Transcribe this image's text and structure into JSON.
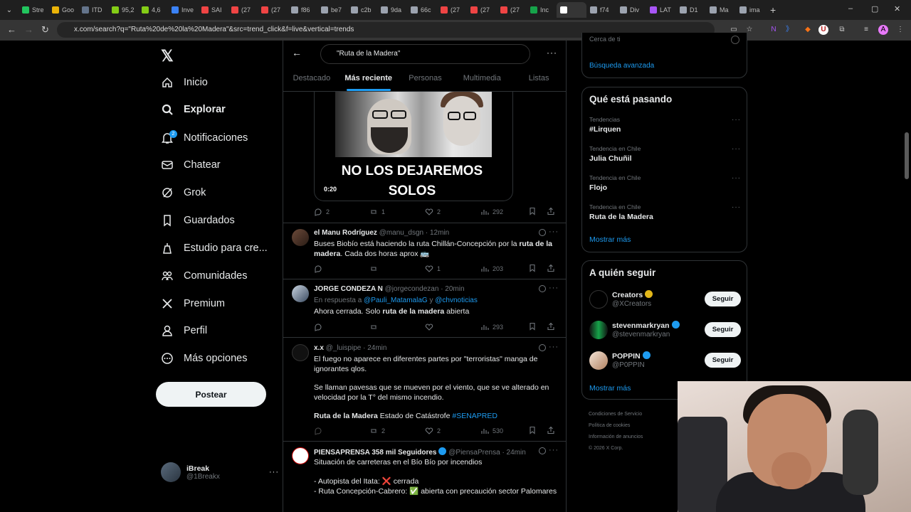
{
  "browser": {
    "tabs": [
      "Stre",
      "Goo",
      "ITD",
      "95,2",
      "4,6",
      "Inve",
      "SAI",
      "(27",
      "(27",
      "f86",
      "be7",
      "c2b",
      "9da",
      "66c",
      "(27",
      "(27",
      "(27",
      "Inc",
      "",
      "f74",
      "Div",
      "LAT",
      "D1",
      "Ma",
      "ima"
    ],
    "url": "x.com/search?q=\"Ruta%20de%20la%20Madera\"&src=trend_click&f=live&vertical=trends"
  },
  "nav": {
    "items": [
      {
        "label": "Inicio",
        "icon": "home-icon"
      },
      {
        "label": "Explorar",
        "icon": "search-icon"
      },
      {
        "label": "Notificaciones",
        "icon": "bell-icon",
        "badge": "2"
      },
      {
        "label": "Chatear",
        "icon": "mail-icon"
      },
      {
        "label": "Grok",
        "icon": "grok-icon"
      },
      {
        "label": "Guardados",
        "icon": "bookmark-icon"
      },
      {
        "label": "Estudio para cre...",
        "icon": "studio-icon"
      },
      {
        "label": "Comunidades",
        "icon": "communities-icon"
      },
      {
        "label": "Premium",
        "icon": "x-icon"
      },
      {
        "label": "Perfil",
        "icon": "person-icon"
      },
      {
        "label": "Más opciones",
        "icon": "more-circle-icon"
      }
    ],
    "post_label": "Postear",
    "profile": {
      "name": "iBreak",
      "handle": "@1Breakx"
    }
  },
  "search": {
    "query": "\"Ruta de la Madera\"",
    "tabs": [
      "Destacado",
      "Más reciente",
      "Personas",
      "Multimedia",
      "Listas"
    ],
    "active_tab": "Más reciente"
  },
  "media_post": {
    "caption_line1": "NO LOS DEJAREMOS",
    "caption_line2": "SOLOS",
    "duration": "0:20",
    "replies": "2",
    "reposts": "1",
    "likes": "2",
    "views": "292"
  },
  "tweets": [
    {
      "name": "el Manu Rodríguez",
      "handle": "@manu_dsgn",
      "time": "· 12min",
      "text_pre": "Buses Biobío está haciendo la ruta Chillán-Concepción por la ",
      "text_bold": "ruta de la madera",
      "text_post": ". Cada dos horas aprox 🚌",
      "replies": "",
      "reposts": "",
      "likes": "1",
      "views": "203"
    },
    {
      "name": "JORGE CONDEZA N",
      "handle": "@jorgecondezan",
      "time": "· 20min",
      "reply_prefix": "En respuesta a ",
      "reply_a": "@Pauli_MatamalaG",
      "reply_and": " y ",
      "reply_b": "@chvnoticias",
      "text_pre": "Ahora cerrada. Solo ",
      "text_bold": "ruta de la madera",
      "text_post": " abierta",
      "replies": "",
      "reposts": "",
      "likes": "",
      "views": "293"
    },
    {
      "name": "x.x",
      "handle": "@_luispipe",
      "time": "· 24min",
      "line1": "El fuego no aparece en diferentes partes por \"terroristas\" manga de ignorantes qlos.",
      "line2": "Se llaman pavesas que se mueven por el viento, que se ve alterado en velocidad por la T° del mismo incendio.",
      "line3_bold": "Ruta de la Madera",
      "line3_text": " Estado de Catástrofe ",
      "line3_tag": "#SENAPRED",
      "replies": "",
      "reposts": "2",
      "likes": "2",
      "views": "530"
    },
    {
      "name": "PIENSAPRENSA 358 mil Seguidores",
      "handle": "@PiensaPrensa",
      "time": "· 24min",
      "line1": "Situación de carreteras en el Bío Bío por incendios",
      "line2": "- Autopista del Itata: ❌ cerrada",
      "line3": "- Ruta Concepción-Cabrero: ✅ abierta con precaución sector Palomares"
    }
  ],
  "right": {
    "advanced_search": "Búsqueda avanzada",
    "clipped_text": "Cerca de ti",
    "trending_title": "Qué está pasando",
    "trends": [
      {
        "label": "Tendencias",
        "name": "#Lirquen"
      },
      {
        "label": "Tendencia en Chile",
        "name": "Julia Chuñil"
      },
      {
        "label": "Tendencia en Chile",
        "name": "Flojo"
      },
      {
        "label": "Tendencia en Chile",
        "name": "Ruta de la Madera"
      }
    ],
    "show_more": "Mostrar más",
    "who_title": "A quién seguir",
    "who": [
      {
        "name": "Creators",
        "handle": "@XCreators",
        "verified": "gold"
      },
      {
        "name": "stevenmarkryan",
        "handle": "@stevenmarkryan",
        "verified": "blue"
      },
      {
        "name": "POPPIN",
        "handle": "@P0PPIN",
        "verified": "blue"
      }
    ],
    "follow_label": "Seguir",
    "footer": [
      "Condiciones de Servicio",
      "Política de cookies",
      "Información de anuncios",
      "© 2026 X Corp."
    ]
  },
  "colors": {
    "accent": "#1d9bf0",
    "bg": "#000000",
    "text": "#e7e9ea",
    "muted": "#71767b",
    "border": "#2f3336"
  }
}
